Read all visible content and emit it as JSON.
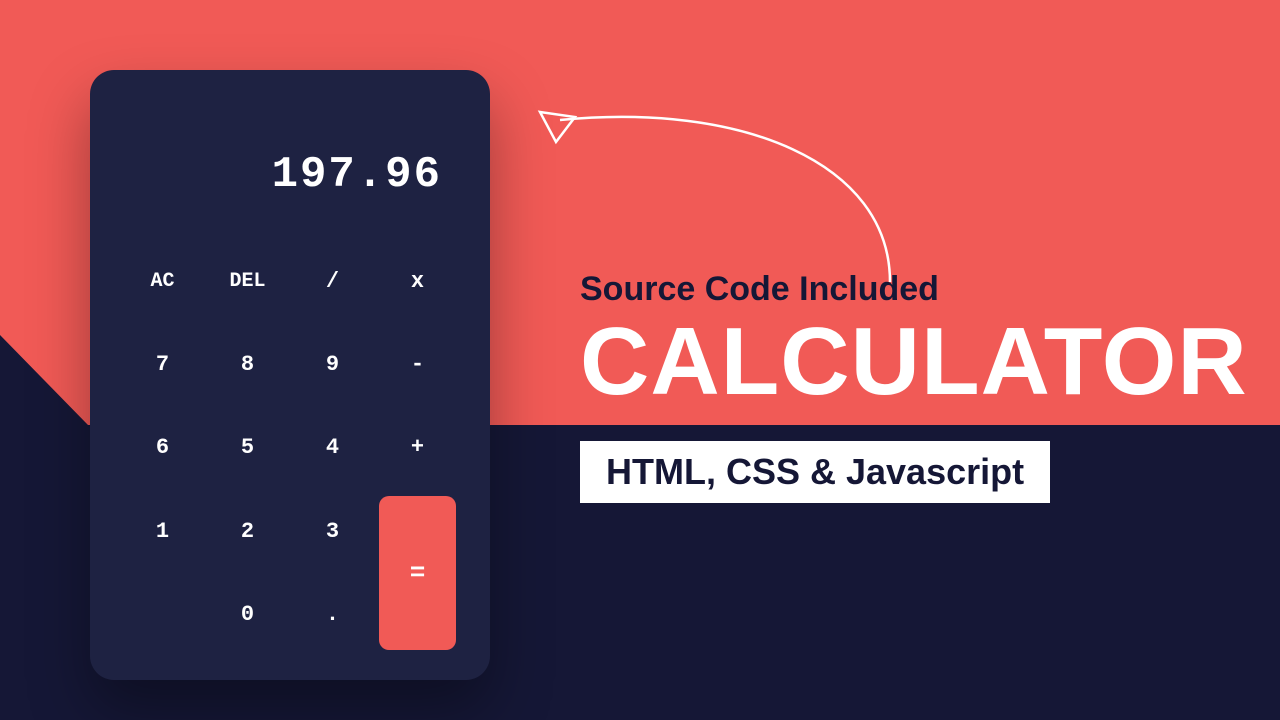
{
  "calculator": {
    "display_value": "197.96",
    "keys": {
      "clear": "AC",
      "delete": "DEL",
      "divide": "/",
      "multiply": "x",
      "seven": "7",
      "eight": "8",
      "nine": "9",
      "subtract": "-",
      "six": "6",
      "five": "5",
      "four": "4",
      "add": "+",
      "one": "1",
      "two": "2",
      "three": "3",
      "equals": "=",
      "zero": "0",
      "decimal": "."
    }
  },
  "promo": {
    "subtitle": "Source Code Included",
    "title": "CALCULATOR",
    "tag": "HTML, CSS & Javascript"
  },
  "colors": {
    "accent": "#f15a56",
    "dark": "#151736",
    "panel": "#1e2242"
  }
}
